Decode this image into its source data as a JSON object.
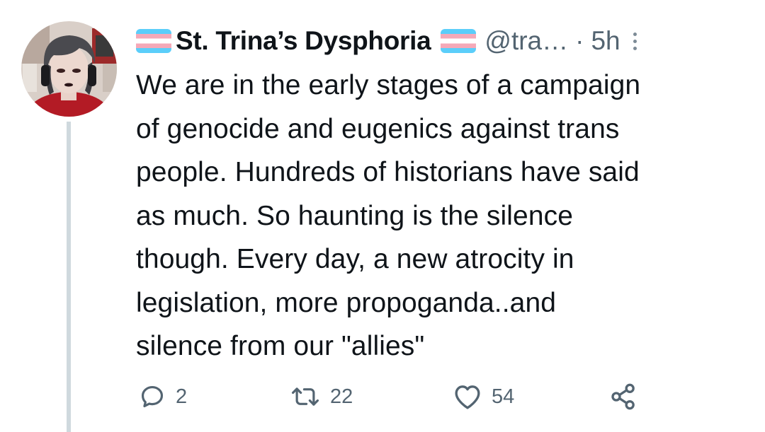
{
  "tweet": {
    "display_name": "St. Trina’s Dysphoria",
    "handle": "@tra…",
    "separator": "·",
    "time": "5h",
    "text": "We are in the early stages of a campaign\nof genocide and eugenics against trans\npeople. Hundreds of historians have said\nas much. So haunting is the silence\nthough. Every day, a new atrocity in\nlegislation, more propoganda..and\nsilence from our \"allies\"",
    "replies": "2",
    "retweets": "22",
    "likes": "54"
  },
  "icons": {
    "flag": "transgender-flag-emoji",
    "more": "more-vertical-icon",
    "reply": "reply-icon",
    "retweet": "retweet-icon",
    "like": "heart-icon",
    "share": "share-icon"
  },
  "colors": {
    "text": "#0f1419",
    "secondary": "#536471",
    "flag_blue": "#5bcefa",
    "flag_pink": "#f5a9b8",
    "flag_white": "#ffffff",
    "thread_line": "#cfd9de"
  }
}
